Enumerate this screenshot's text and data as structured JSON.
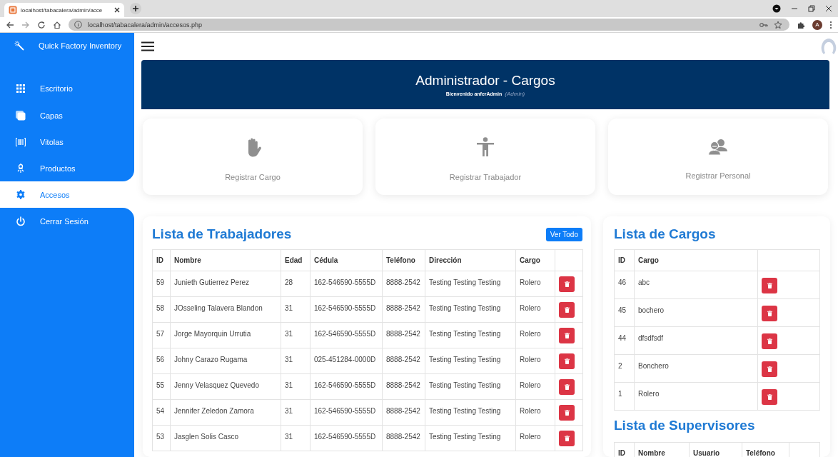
{
  "browser": {
    "tab_title": "localhost/tabacalera/admin/acce",
    "url": "localhost/tabacalera/admin/accesos.php",
    "profile_initial": "A"
  },
  "sidebar": {
    "brand": "Quick Factory Inventory",
    "items": [
      {
        "label": "Escritorio",
        "selected": false
      },
      {
        "label": "Capas",
        "selected": false
      },
      {
        "label": "Vitolas",
        "selected": false
      },
      {
        "label": "Productos",
        "selected": false
      },
      {
        "label": "Accesos",
        "selected": true
      },
      {
        "label": "Cerrar Sesión",
        "selected": false
      }
    ]
  },
  "banner": {
    "title": "Administrador - Cargos",
    "welcome": "Bienvenido anferAdmin",
    "role": "(Admin)"
  },
  "actions": [
    {
      "label": "Registrar Cargo"
    },
    {
      "label": "Registrar Trabajador"
    },
    {
      "label": "Registrar Personal"
    }
  ],
  "workers": {
    "title": "Lista de Trabajadores",
    "view_all": "Ver Todo",
    "columns": [
      "ID",
      "Nombre",
      "Edad",
      "Cédula",
      "Teléfono",
      "Dirección",
      "Cargo"
    ],
    "rows": [
      [
        "59",
        "Junieth Gutierrez Perez",
        "28",
        "162-546590-5555D",
        "8888-2542",
        "Testing Testing Testing",
        "Rolero"
      ],
      [
        "58",
        "JOsseling Talavera Blandon",
        "31",
        "162-546590-5555D",
        "8888-2542",
        "Testing Testing Testing",
        "Rolero"
      ],
      [
        "57",
        "Jorge Mayorquin Urrutia",
        "31",
        "162-546590-5555D",
        "8888-2542",
        "Testing Testing Testing",
        "Rolero"
      ],
      [
        "56",
        "Johny Carazo Rugama",
        "31",
        "025-451284-0000D",
        "8888-2542",
        "Testing Testing Testing",
        "Rolero"
      ],
      [
        "55",
        "Jenny Velasquez Quevedo",
        "31",
        "162-546590-5555D",
        "8888-2542",
        "Testing Testing Testing",
        "Rolero"
      ],
      [
        "54",
        "Jennifer Zeledon Zamora",
        "31",
        "162-546590-5555D",
        "8888-2542",
        "Testing Testing Testing",
        "Rolero"
      ],
      [
        "53",
        "Jasglen Solis Casco",
        "31",
        "162-546590-5555D",
        "8888-2542",
        "Testing Testing Testing",
        "Rolero"
      ]
    ]
  },
  "cargos": {
    "title": "Lista de Cargos",
    "columns": [
      "ID",
      "Cargo"
    ],
    "rows": [
      [
        "46",
        "abc"
      ],
      [
        "45",
        "bochero"
      ],
      [
        "44",
        "dfsdfsdf"
      ],
      [
        "2",
        "Bonchero"
      ],
      [
        "1",
        "Rolero"
      ]
    ]
  },
  "supervisors": {
    "title": "Lista de Supervisores",
    "columns": [
      "ID",
      "Nombre",
      "Usuario",
      "Teléfono"
    ]
  }
}
